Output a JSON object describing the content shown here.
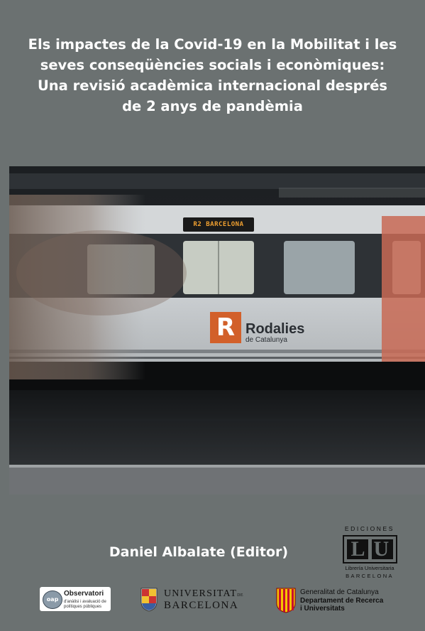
{
  "title": {
    "lines": [
      "Els impactes de la Covid-19 en la Mobilitat i les",
      "seves conseqüències socials i econòmiques:",
      "Una revisió acadèmica internacional després",
      "de 2 anys de pandèmia"
    ]
  },
  "photo": {
    "train_display": "R2 BARCELONA",
    "brand_letter": "R",
    "brand_name": "Rodalies",
    "brand_sub": "de Catalunya"
  },
  "editor": "Daniel Albalate (Editor)",
  "publisher": {
    "ediciones": "EDICIONES",
    "logo_letters": "LU",
    "line1": "Librería Universitaria",
    "line2": "BARCELONA"
  },
  "logos": {
    "observatori": {
      "abbr": "oap",
      "name": "Observatori",
      "desc": "d'anàlisi i avaluació de polítiques públiques"
    },
    "ub": {
      "line1": "UNIVERSITAT",
      "line1_suffix": "DE",
      "line2": "BARCELONA"
    },
    "generalitat": {
      "line1": "Generalitat de Catalunya",
      "line2": "Departament de Recerca",
      "line3": "i Universitats"
    }
  },
  "colors": {
    "background": "#6b7171",
    "title_text": "#ffffff",
    "rodalies_orange": "#d2602a",
    "display_amber": "#f0a030"
  }
}
